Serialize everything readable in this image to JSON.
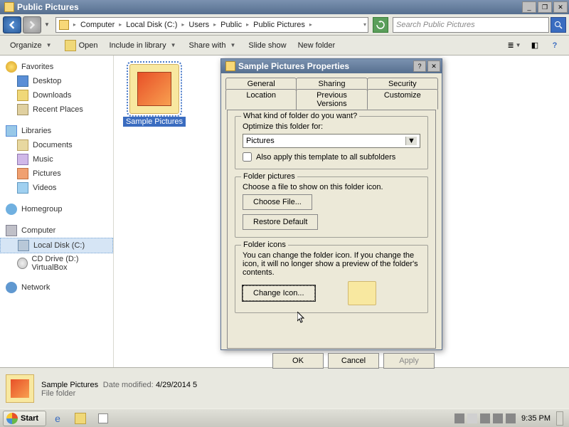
{
  "window": {
    "title": "Public Pictures"
  },
  "breadcrumb": [
    "Computer",
    "Local Disk (C:)",
    "Users",
    "Public",
    "Public Pictures"
  ],
  "search": {
    "placeholder": "Search Public Pictures"
  },
  "toolbar": {
    "organize": "Organize",
    "open": "Open",
    "include": "Include in library",
    "share": "Share with",
    "slideshow": "Slide show",
    "newfolder": "New folder"
  },
  "sidebar": {
    "favorites": {
      "label": "Favorites",
      "items": [
        "Desktop",
        "Downloads",
        "Recent Places"
      ]
    },
    "libraries": {
      "label": "Libraries",
      "items": [
        "Documents",
        "Music",
        "Pictures",
        "Videos"
      ]
    },
    "homegroup": {
      "label": "Homegroup"
    },
    "computer": {
      "label": "Computer",
      "items": [
        "Local Disk (C:)",
        "CD Drive (D:) VirtualBox"
      ]
    },
    "network": {
      "label": "Network"
    }
  },
  "content": {
    "folder": "Sample Pictures"
  },
  "details": {
    "name": "Sample Pictures",
    "mod_label": "Date modified:",
    "mod_value": "4/29/2014 5",
    "type": "File folder"
  },
  "dialog": {
    "title": "Sample Pictures Properties",
    "tabs_top": [
      "General",
      "Sharing",
      "Security"
    ],
    "tabs_bottom": [
      "Location",
      "Previous Versions",
      "Customize"
    ],
    "kind": {
      "legend": "What kind of folder do you want?",
      "label": "Optimize this folder for:",
      "value": "Pictures",
      "check": "Also apply this template to all subfolders"
    },
    "fp": {
      "legend": "Folder pictures",
      "text": "Choose a file to show on this folder icon.",
      "choose": "Choose File...",
      "restore": "Restore Default"
    },
    "fi": {
      "legend": "Folder icons",
      "text": "You can change the folder icon. If you change the icon, it will no longer show a preview of the folder's contents.",
      "change": "Change Icon..."
    },
    "ok": "OK",
    "cancel": "Cancel",
    "apply": "Apply"
  },
  "taskbar": {
    "start": "Start",
    "time": "9:35 PM"
  }
}
